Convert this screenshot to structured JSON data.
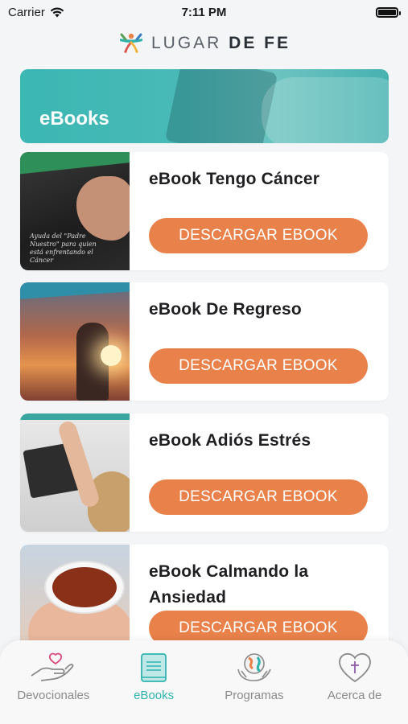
{
  "status_bar": {
    "carrier": "Carrier",
    "time": "7:11 PM",
    "battery_level": 1.0
  },
  "brand": {
    "name_light": "LUGAR",
    "name_bold": "DE FE"
  },
  "hero": {
    "title": "eBooks"
  },
  "ebooks": [
    {
      "title": "eBook Tengo Cáncer",
      "button_label": "DESCARGAR EBOOK",
      "cover_text": "Ayuda del \"Padre Nuestro\" para quien está enfrentando el Cáncer"
    },
    {
      "title": "eBook De Regreso",
      "button_label": "DESCARGAR EBOOK"
    },
    {
      "title": "eBook Adiós Estrés",
      "button_label": "DESCARGAR EBOOK"
    },
    {
      "title": "eBook Calmando la Ansiedad",
      "button_label": "DESCARGAR EBOOK"
    }
  ],
  "tabs": [
    {
      "label": "Devocionales",
      "icon": "heart-hand-icon",
      "active": false
    },
    {
      "label": "eBooks",
      "icon": "book-icon",
      "active": true
    },
    {
      "label": "Programas",
      "icon": "globe-hands-icon",
      "active": false
    },
    {
      "label": "Acerca de",
      "icon": "heart-cross-icon",
      "active": false
    }
  ],
  "colors": {
    "accent": "#2fb3ae",
    "button": "#e8814a",
    "hero": "#3bb7b4"
  }
}
